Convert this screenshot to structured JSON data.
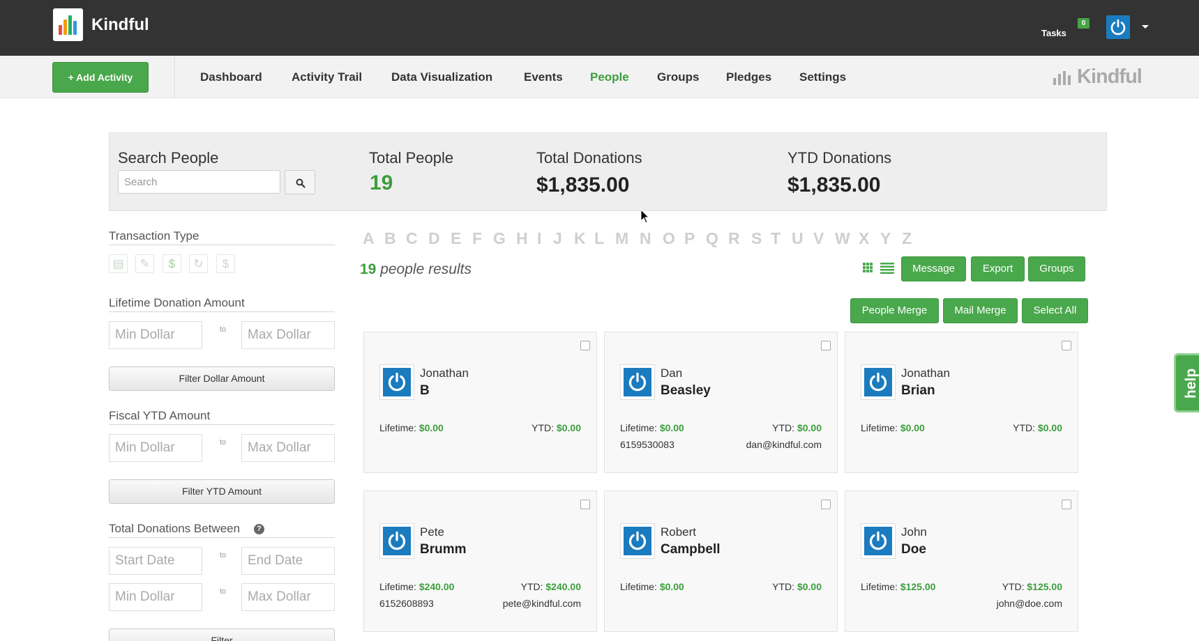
{
  "header": {
    "brand": "Kindful",
    "tasks_label": "Tasks",
    "tasks_count": "0"
  },
  "nav": {
    "add_activity": "+ Add Activity",
    "items": [
      "Dashboard",
      "Activity Trail",
      "Data Visualization",
      "Events",
      "People",
      "Groups",
      "Pledges",
      "Settings"
    ],
    "active": "People",
    "logo_text": "Kindful"
  },
  "stats": {
    "search_label": "Search People",
    "search_placeholder": "Search",
    "total_people_label": "Total People",
    "total_people": "19",
    "total_donations_label": "Total Donations",
    "total_donations": "$1,835.00",
    "ytd_label": "YTD Donations",
    "ytd": "$1,835.00"
  },
  "sidebar": {
    "transaction_type": "Transaction Type",
    "transaction_icons": [
      "card-icon",
      "check-icon",
      "dollar-icon",
      "recurring-icon",
      "dollar-outline-icon"
    ],
    "lifetime_heading": "Lifetime Donation Amount",
    "fiscal_heading": "Fiscal YTD Amount",
    "total_between_heading": "Total Donations Between",
    "min_dollar": "Min Dollar",
    "max_dollar": "Max Dollar",
    "start_date": "Start Date",
    "end_date": "End Date",
    "to": "to",
    "filter_dollar": "Filter Dollar Amount",
    "filter_ytd": "Filter YTD Amount",
    "filter": "Filter",
    "help_mark": "?"
  },
  "alphabet": [
    "A",
    "B",
    "C",
    "D",
    "E",
    "F",
    "G",
    "H",
    "I",
    "J",
    "K",
    "L",
    "M",
    "N",
    "O",
    "P",
    "Q",
    "R",
    "S",
    "T",
    "U",
    "V",
    "W",
    "X",
    "Y",
    "Z"
  ],
  "results": {
    "count": "19",
    "label": "people results"
  },
  "actions": {
    "message": "Message",
    "export": "Export",
    "groups": "Groups",
    "people_merge": "People Merge",
    "mail_merge": "Mail Merge",
    "select_all": "Select All"
  },
  "labels": {
    "lifetime": "Lifetime:",
    "ytd": "YTD:"
  },
  "people": [
    {
      "first": "Jonathan",
      "last": "B",
      "lifetime": "$0.00",
      "ytd": "$0.00",
      "phone": "",
      "email": ""
    },
    {
      "first": "Dan",
      "last": "Beasley",
      "lifetime": "$0.00",
      "ytd": "$0.00",
      "phone": "6159530083",
      "email": "dan@kindful.com"
    },
    {
      "first": "Jonathan",
      "last": "Brian",
      "lifetime": "$0.00",
      "ytd": "$0.00",
      "phone": "",
      "email": ""
    },
    {
      "first": "Pete",
      "last": "Brumm",
      "lifetime": "$240.00",
      "ytd": "$240.00",
      "phone": "6152608893",
      "email": "pete@kindful.com"
    },
    {
      "first": "Robert",
      "last": "Campbell",
      "lifetime": "$0.00",
      "ytd": "$0.00",
      "phone": "",
      "email": ""
    },
    {
      "first": "John",
      "last": "Doe",
      "lifetime": "$125.00",
      "ytd": "$125.00",
      "phone": "",
      "email": "john@doe.com"
    }
  ],
  "help_tab": "help",
  "colors": {
    "accent_green": "#49a84b",
    "topbar": "#333333",
    "avatar_blue": "#1a7bbf"
  }
}
